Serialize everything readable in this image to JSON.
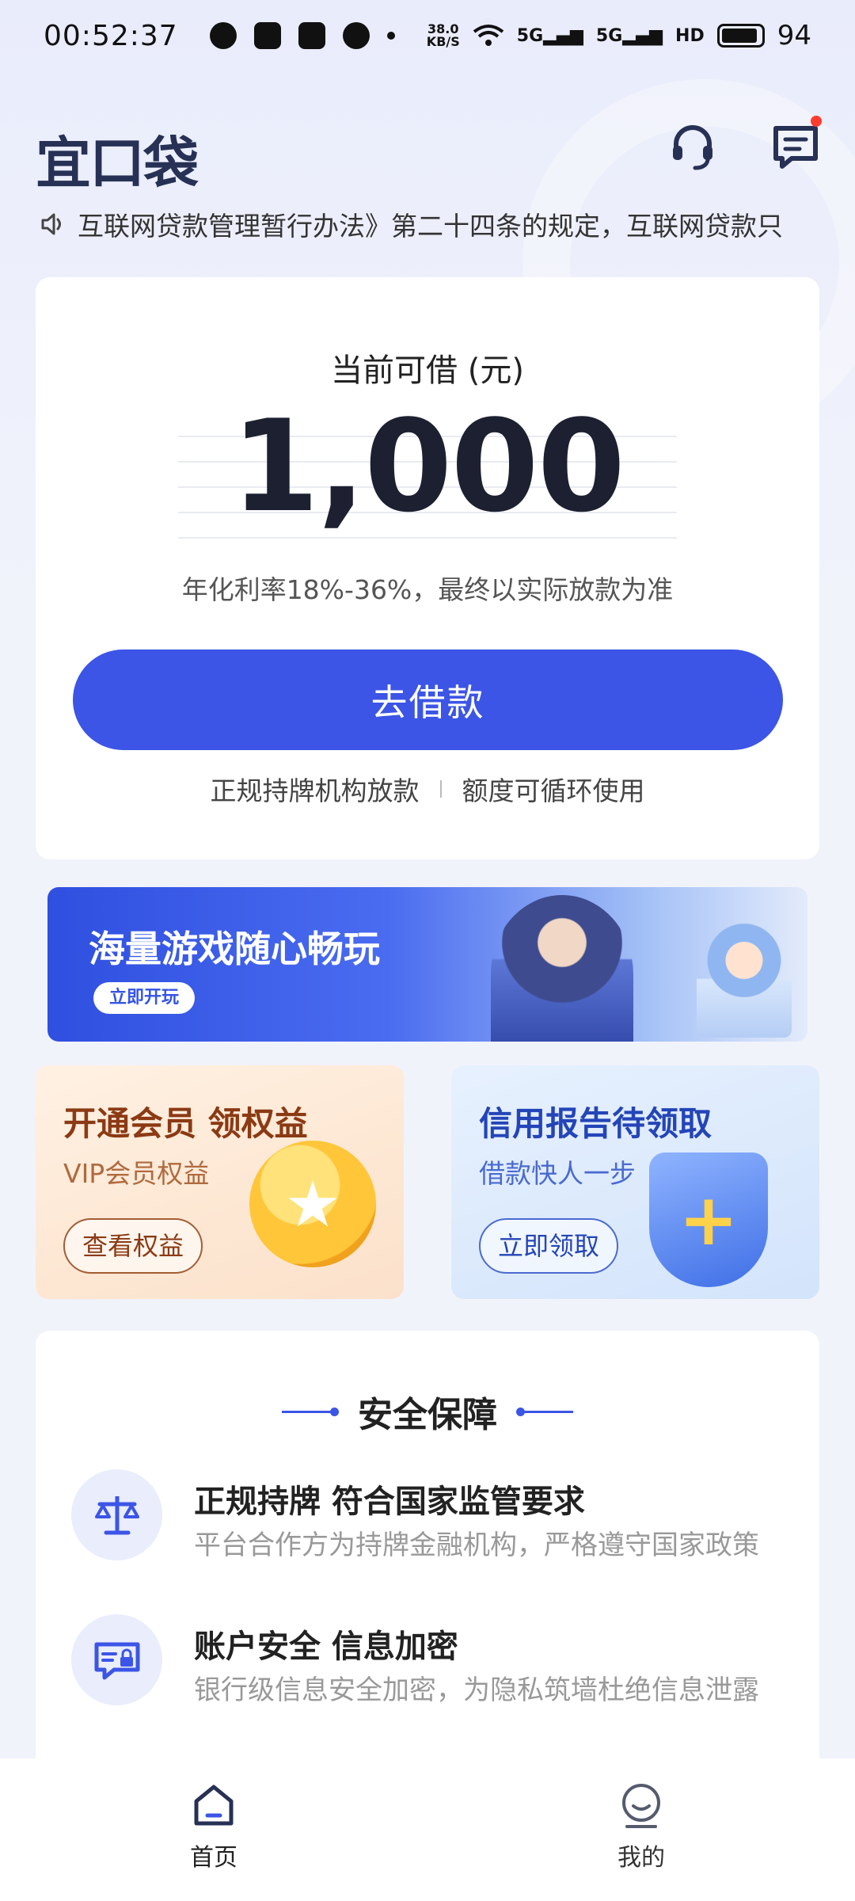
{
  "status_bar": {
    "time": "00:52:37",
    "net_speed_value": "38.0",
    "net_speed_unit": "KB/S",
    "signal1": "5G",
    "signal2": "5G",
    "hd": "HD",
    "battery": "94"
  },
  "header": {
    "logo": "宜口袋",
    "icons": [
      "headset-icon",
      "message-icon"
    ]
  },
  "notice": {
    "text": "互联网贷款管理暂行办法》第二十四条的规定，互联网贷款只"
  },
  "loan_card": {
    "label": "当前可借 (元)",
    "amount": "1,000",
    "rate_note": "年化利率18%-36%，最终以实际放款为准",
    "button": "去借款",
    "feature1": "正规持牌机构放款",
    "feature2": "额度可循环使用"
  },
  "banner": {
    "title": "海量游戏随心畅玩",
    "cta": "立即开玩"
  },
  "promos": {
    "vip": {
      "title": "开通会员 领权益",
      "subtitle": "VIP会员权益",
      "button": "查看权益"
    },
    "credit": {
      "title": "信用报告待领取",
      "subtitle": "借款快人一步",
      "button": "立即领取"
    }
  },
  "security": {
    "heading": "安全保障",
    "items": [
      {
        "title": "正规持牌 符合国家监管要求",
        "desc": "平台合作方为持牌金融机构，严格遵守国家政策"
      },
      {
        "title": "账户安全 信息加密",
        "desc": "银行级信息安全加密，为隐私筑墙杜绝信息泄露"
      }
    ]
  },
  "bottom_nav": {
    "items": [
      {
        "label": "首页",
        "active": true
      },
      {
        "label": "我的",
        "active": false
      }
    ]
  },
  "colors": {
    "accent": "#3c55e6",
    "background": "#f1f3fb",
    "logo": "#273155"
  }
}
